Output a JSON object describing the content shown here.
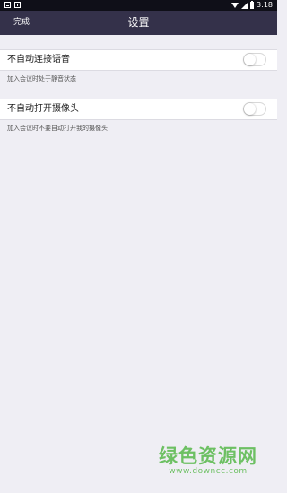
{
  "status_bar": {
    "time": "3:18",
    "left_icons": [
      "notification-icon",
      "download-icon"
    ],
    "right_icons": [
      "wifi-icon",
      "signal-icon",
      "battery-icon"
    ]
  },
  "nav": {
    "done_label": "完成",
    "title": "设置",
    "background": "#34314a"
  },
  "settings": [
    {
      "label": "不自动连接语音",
      "description": "加入会议时处于静音状态",
      "enabled": false
    },
    {
      "label": "不自动打开摄像头",
      "description": "加入会议时不要自动打开我的摄像头",
      "enabled": false
    }
  ],
  "watermark": {
    "title": "绿色资源网",
    "url": "www.downcc.com",
    "color": "#57b84a"
  }
}
